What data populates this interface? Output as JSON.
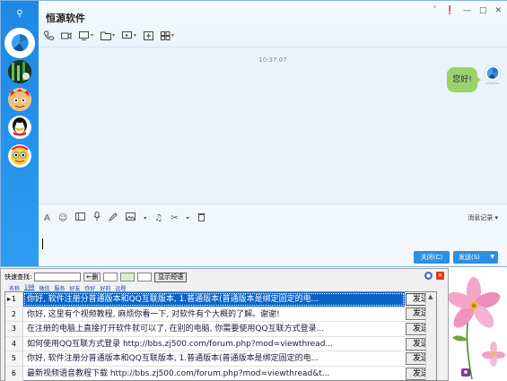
{
  "chat": {
    "title": "恒源软件",
    "timestamp": "10:37:07",
    "message": "您好!",
    "history_label": "消息记录",
    "close_label": "关闭(C)",
    "send_label": "发送(S)"
  },
  "quick": {
    "search_label": "快速查找:",
    "delete_label": "←删",
    "show_label": "显示短语",
    "categories": [
      "名称",
      "198",
      "微信",
      "服务",
      "好友",
      "你好",
      "好的",
      "远程"
    ],
    "send_label": "发送",
    "rows": [
      {
        "num": "1",
        "text": "你好, 软件注册分普通版本和QQ互联版本, 1.普通版本(普通版本是绑定固定的电..."
      },
      {
        "num": "2",
        "text": "你好, 这里有个视频教程, 麻烦你看一下, 对软件有个大概的了解。谢谢!"
      },
      {
        "num": "3",
        "text": "在注册的电脑上直接打开软件就可以了, 在别的电脑, 你需要使用QQ互联方式登录..."
      },
      {
        "num": "4",
        "text": "如何使用QQ互联方式登录 http://bbs.zj500.com/forum.php?mod=viewthread..."
      },
      {
        "num": "5",
        "text": "你好, 软件注册分普通版本和QQ互联版本, 1.普通版本(普通版本是绑定固定的电..."
      },
      {
        "num": "6",
        "text": "最新视频语音教程下载 http://bbs.zj500.com/forum.php?mod=viewthread&t..."
      }
    ]
  },
  "colors": {
    "sidebar": "#1e88e5",
    "bubble": "#9bd36a",
    "selection": "#0a64c8",
    "button": "#2d8fe0"
  }
}
